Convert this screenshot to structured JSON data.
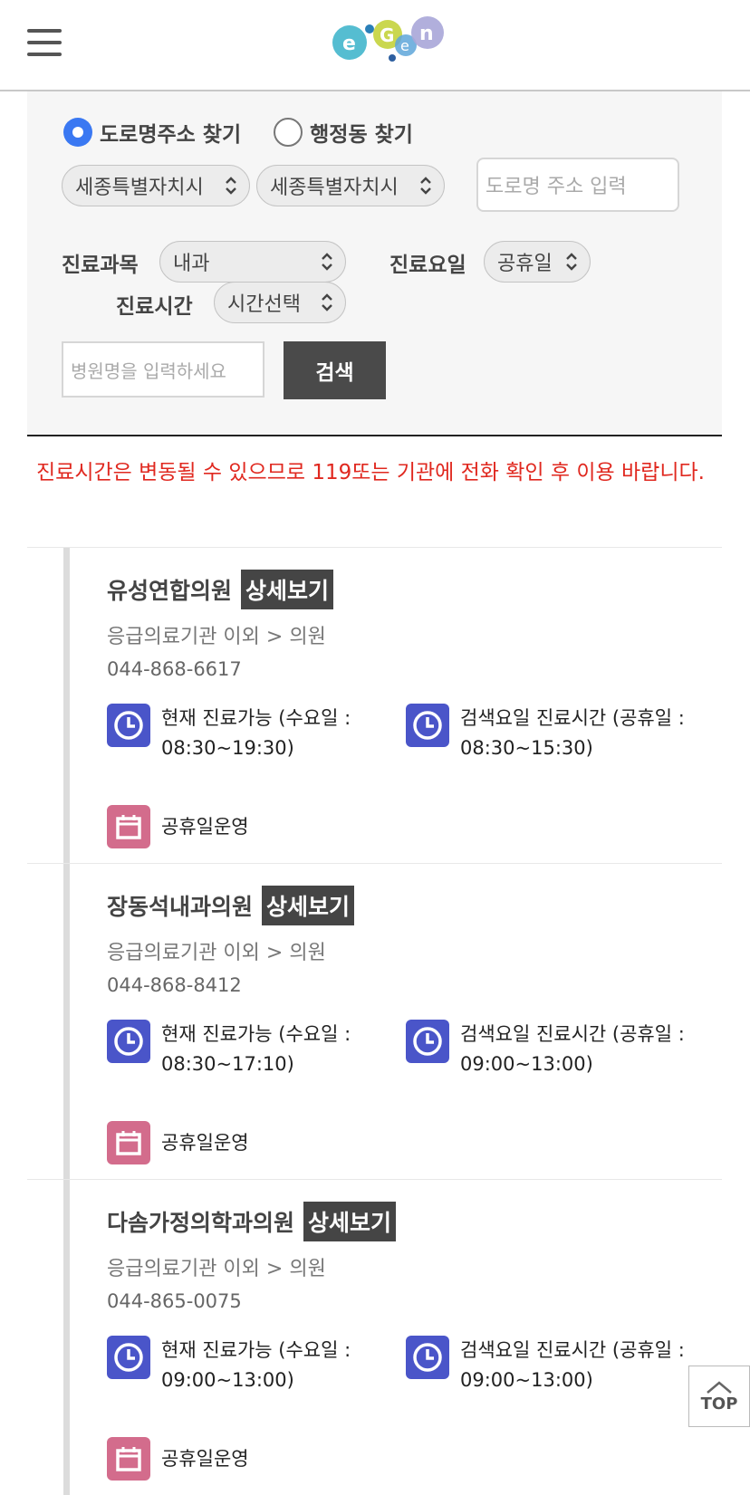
{
  "header": {
    "logo_text": "e-gen"
  },
  "search": {
    "radio_road": "도로명주소 찾기",
    "radio_admin": "행정동 찾기",
    "sido": "세종특별자치시",
    "sigungu": "세종특별자치시",
    "road_placeholder": "도로명 주소 입력",
    "dept_label": "진료과목",
    "dept_value": "내과",
    "day_label": "진료요일",
    "day_value": "공휴일",
    "time_label": "진료시간",
    "time_value": "시간선택",
    "hospital_placeholder": "병원명을 입력하세요",
    "search_button": "검색"
  },
  "notice": "진료시간은 변동될 수 있으므로 119또는 기관에 전화 확인 후 이용 바랍니다.",
  "results": [
    {
      "name": "유성연합의원",
      "detail": "상세보기",
      "category": "응급의료기관 이외 > 의원",
      "phone": "044-868-6617",
      "now_line1": "현재 진료가능 (수요일 :",
      "now_line2": "08:30~19:30)",
      "search_line1": "검색요일 진료시간 (공휴일 :",
      "search_line2": "08:30~15:30)",
      "holiday": "공휴일운영"
    },
    {
      "name": "장동석내과의원",
      "detail": "상세보기",
      "category": "응급의료기관 이외 > 의원",
      "phone": "044-868-8412",
      "now_line1": "현재 진료가능 (수요일 :",
      "now_line2": "08:30~17:10)",
      "search_line1": "검색요일 진료시간 (공휴일 :",
      "search_line2": "09:00~13:00)",
      "holiday": "공휴일운영"
    },
    {
      "name": "다솜가정의학과의원",
      "detail": "상세보기",
      "category": "응급의료기관 이외 > 의원",
      "phone": "044-865-0075",
      "now_line1": "현재 진료가능 (수요일 :",
      "now_line2": "09:00~13:00)",
      "search_line1": "검색요일 진료시간 (공휴일 :",
      "search_line2": "09:00~13:00)",
      "holiday": "공휴일운영"
    }
  ],
  "top_button": "TOP",
  "colors": {
    "radio_accent": "#3a78f2",
    "notice_red": "#e0281f",
    "clock_icon_bg": "#4a55c9",
    "calendar_icon_bg": "#d36c8c",
    "dark_button": "#4a4a4a"
  },
  "icons": [
    "menu-icon",
    "clock-icon",
    "calendar-icon",
    "chevron-up-icon",
    "select-chevron-icon"
  ]
}
